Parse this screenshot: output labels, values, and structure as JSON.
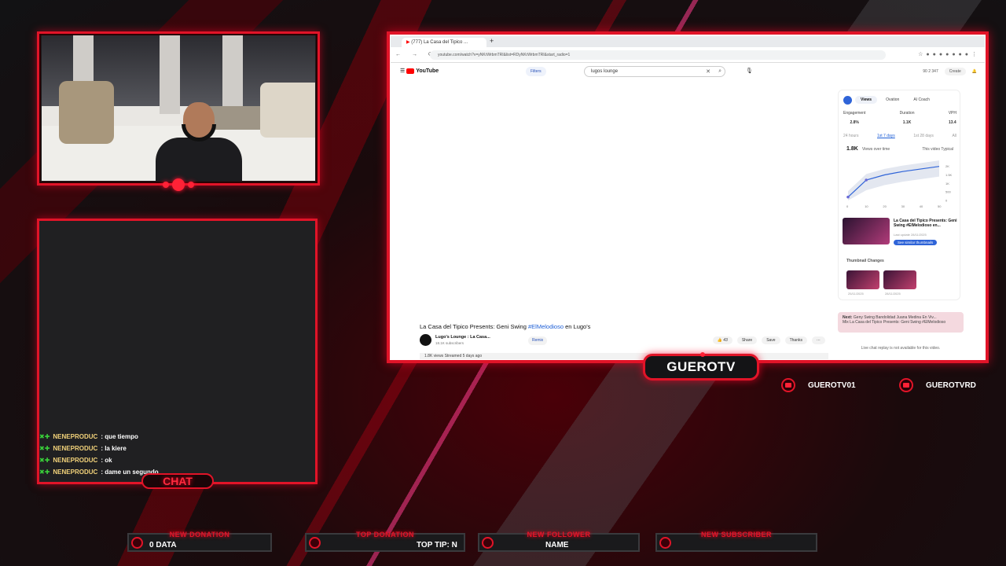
{
  "overlay": {
    "chat_tab_label": "CHAT",
    "streamer_name": "GUEROTV",
    "socials": [
      {
        "handle": "GUEROTV01"
      },
      {
        "handle": "GUEROTVRD"
      }
    ],
    "bars": [
      {
        "label": "NEW DONATION",
        "value": "0 DATA"
      },
      {
        "label": "TOP DONATION",
        "value": "TOP TIP: N"
      },
      {
        "label": "NEW FOLLOWER",
        "value": "NAME"
      },
      {
        "label": "NEW SUBSCRIBER",
        "value": ""
      }
    ],
    "accent_color": "#e11428"
  },
  "chat": {
    "messages": [
      {
        "user": "NENEPRODUC",
        "text": ": que tiempo"
      },
      {
        "user": "NENEPRODUC",
        "text": ": la kiere"
      },
      {
        "user": "NENEPRODUC",
        "text": ": ok"
      },
      {
        "user": "NENEPRODUC",
        "text": ": dame un segundo"
      }
    ]
  },
  "browser": {
    "tab_title": "(777) La Casa del Tipico ...",
    "url": "youtube.com/watch?v=yNKrWrbmTRI&list=RDyNKrWrbmTRI&start_radio=1",
    "youtube": {
      "logo": "YouTube",
      "filters_label": "Filters",
      "search_value": "lugos lounge",
      "header_stats": "90  2  347",
      "create_label": "Create",
      "video_title_prefix": "La Casa del Tipico Presents: Geni Swing ",
      "video_title_tag": "#ElMelodioso",
      "video_title_suffix": " en Lugo's",
      "channel_name": "Lugo's Lounge : La Casa...",
      "channel_subs": "18.1K subscribers",
      "remix_label": "Remix",
      "like_count": "43",
      "share_label": "Share",
      "save_label": "Save",
      "thanks_label": "Thanks",
      "views_line": "1.8K views  Streamed 5 days ago",
      "side_panel": {
        "tabs": [
          "Views",
          "Ovation",
          "AI Coach"
        ],
        "stats": [
          {
            "label": "Engagement",
            "value": "2.8%"
          },
          {
            "label": "Duration",
            "value": "1.1K"
          },
          {
            "label": "VPH",
            "value": "13.4"
          }
        ],
        "ranges": [
          "24 hours",
          "1st 7 days",
          "1st 28 days",
          "All"
        ],
        "view_count": "1.8K",
        "metric_label": "Views over time",
        "legend": "This video  Typical",
        "thumb_title": "La Casa del Tipico Presents: Geni Swing #ElMelodioso en...",
        "thumb_date": "Last update 28/11/2025",
        "thumb_button": "See similar thumbnails",
        "changes_label": "Thumbnail Changes",
        "change_dates": [
          "25/11/2025",
          "28/11/2025"
        ]
      },
      "next_label": "Next:",
      "next_text": "Geny Swing Bandolidad  Juana Medina En Viv...",
      "next_sub": "Mix   La Casa del Tipico Presents: Geni Swing #ElMelodioso",
      "replay_note": "Live chat replay is not available for this video."
    }
  },
  "chart_data": {
    "type": "line",
    "x": [
      0,
      10,
      20,
      30,
      40,
      50
    ],
    "series": [
      {
        "values": [
          0.2,
          1.2,
          1.5,
          1.7,
          1.85,
          2.0
        ]
      }
    ],
    "ytick_labels": [
      "2K",
      "1.5K",
      "1K",
      "500",
      "0"
    ],
    "xtick_labels": [
      "0",
      "10",
      "20",
      "30",
      "40",
      "50"
    ],
    "ylim": [
      0,
      2.4
    ],
    "xlim": [
      0,
      50
    ]
  }
}
